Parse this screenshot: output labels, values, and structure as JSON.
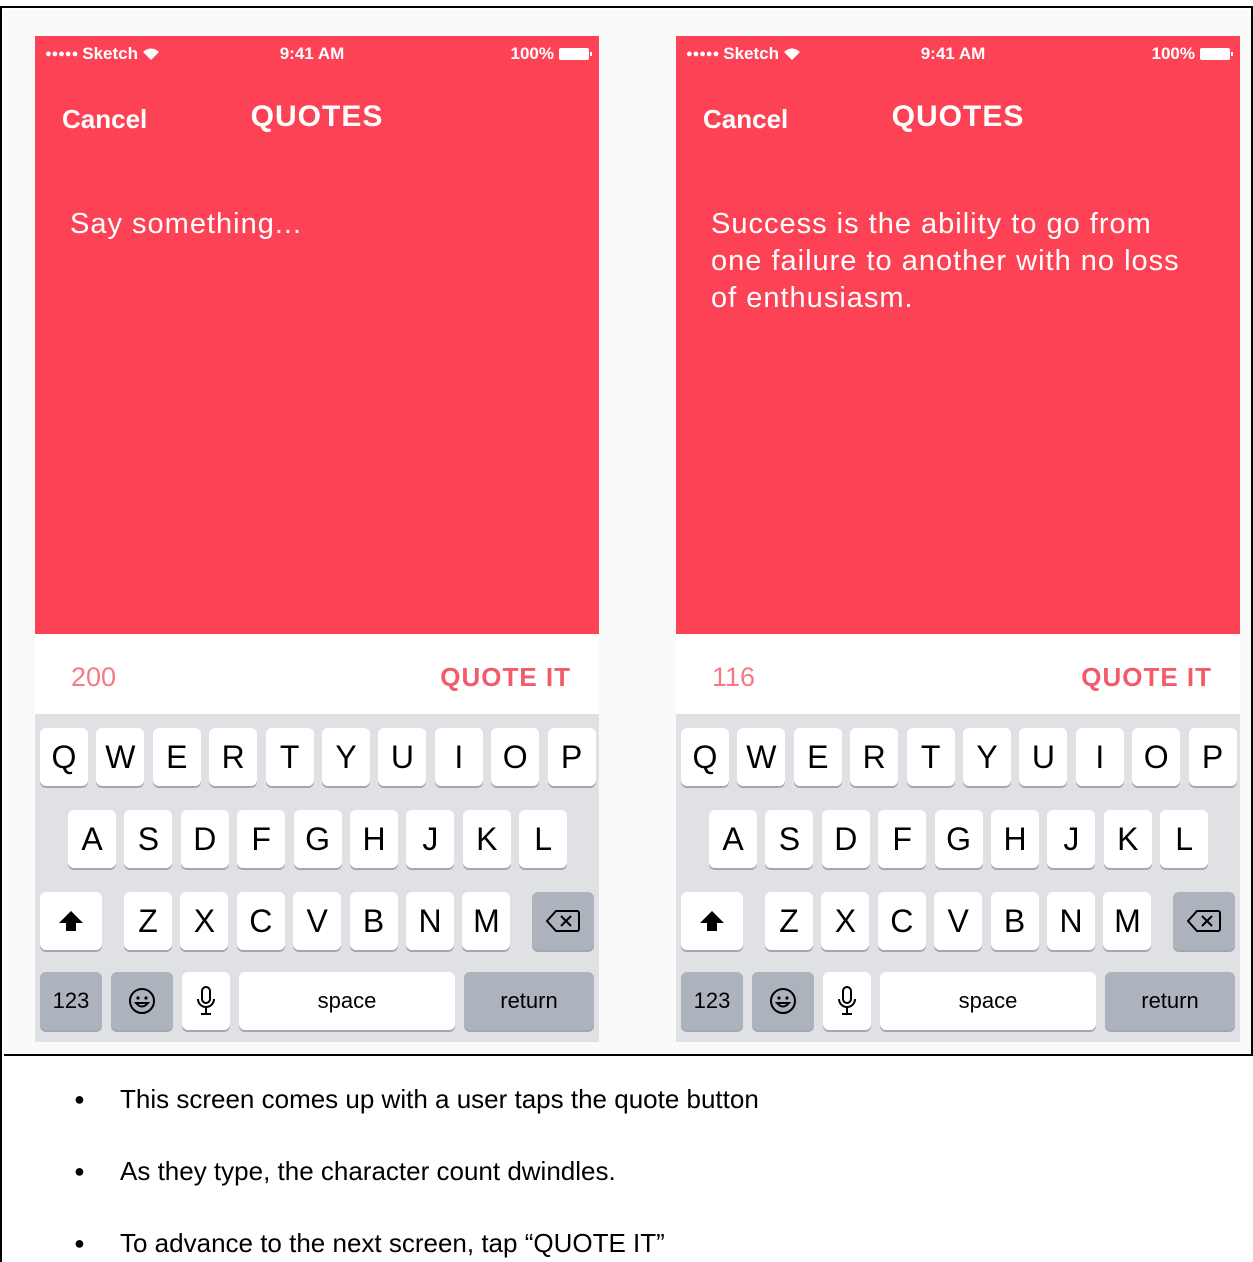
{
  "screens": [
    {
      "status": {
        "carrier": "Sketch",
        "time": "9:41 AM",
        "battery": "100%"
      },
      "nav": {
        "cancel": "Cancel",
        "title": "QUOTES"
      },
      "text": "Say something...",
      "count": "200",
      "action": "QUOTE IT"
    },
    {
      "status": {
        "carrier": "Sketch",
        "time": "9:41 AM",
        "battery": "100%"
      },
      "nav": {
        "cancel": "Cancel",
        "title": "QUOTES"
      },
      "text": "Success is the ability to go from one failure to another with no loss of enthusiasm.",
      "count": "116",
      "action": "QUOTE IT"
    }
  ],
  "keyboard": {
    "row1": [
      "Q",
      "W",
      "E",
      "R",
      "T",
      "Y",
      "U",
      "I",
      "O",
      "P"
    ],
    "row2": [
      "A",
      "S",
      "D",
      "F",
      "G",
      "H",
      "J",
      "K",
      "L"
    ],
    "row3": [
      "Z",
      "X",
      "C",
      "V",
      "B",
      "N",
      "M"
    ],
    "numbers": "123",
    "space": "space",
    "return": "return",
    "icons": {
      "shift": "shift-icon",
      "delete": "delete-icon",
      "emoji": "emoji-icon",
      "mic": "microphone-icon"
    }
  },
  "notes": [
    "This screen comes up with a user taps the quote button",
    "As they type, the character count dwindles.",
    "To advance to the next screen, tap “QUOTE IT”"
  ],
  "colors": {
    "accent": "#fe4255",
    "count": "#f67a86",
    "action": "#f45b6a",
    "keyboard": "#dfe1e5"
  }
}
